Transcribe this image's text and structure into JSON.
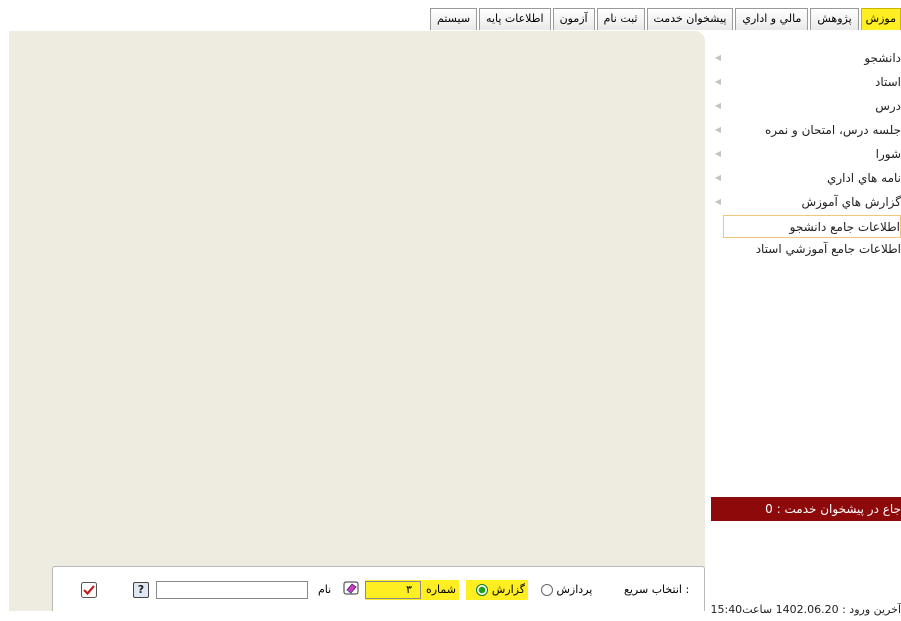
{
  "tabs": [
    {
      "label": "موزش",
      "active": true
    },
    {
      "label": "پژوهش",
      "active": false
    },
    {
      "label": "مالي و اداري",
      "active": false
    },
    {
      "label": "پيشخوان خدمت",
      "active": false
    },
    {
      "label": "ثبت نام",
      "active": false
    },
    {
      "label": "آزمون",
      "active": false
    },
    {
      "label": "اطلاعات پايه",
      "active": false
    },
    {
      "label": "سيستم",
      "active": false
    }
  ],
  "menu": {
    "items": [
      {
        "label": "دانشجو",
        "has_arrow": true
      },
      {
        "label": "استاد",
        "has_arrow": true
      },
      {
        "label": "درس",
        "has_arrow": true
      },
      {
        "label": "جلسه درس، امتحان و نمره",
        "has_arrow": true
      },
      {
        "label": "شورا",
        "has_arrow": true
      },
      {
        "label": "نامه هاي اداري",
        "has_arrow": true
      },
      {
        "label": "گزارش هاي آموزش",
        "has_arrow": true
      },
      {
        "label": "اطلاعات جامع دانشجو",
        "has_arrow": false,
        "selected": true
      },
      {
        "label": "اطلاعات جامع آموزشي استاد",
        "has_arrow": false
      }
    ],
    "arrow_icon": "triangle-left-icon"
  },
  "status": {
    "referral_text": "جاع در پيشخوان خدمت : 0",
    "last_login": "آخرين ورود : 1402.06.20 ساعت15:40"
  },
  "quickbar": {
    "label": "انتخاب سريع :",
    "radio_process_label": "پردازش",
    "radio_report_label": "گزارش",
    "selected_radio": "report",
    "number_label": "شماره",
    "number_value": "۳",
    "name_label": "نام",
    "name_value": "",
    "icons": [
      "eraser-icon",
      "help-icon",
      "checkmark-icon"
    ]
  },
  "colors": {
    "tab_active": "#ffee22",
    "content_bg": "#eeebe0",
    "status_red": "#8e0a0a",
    "highlight": "#ffee22"
  }
}
